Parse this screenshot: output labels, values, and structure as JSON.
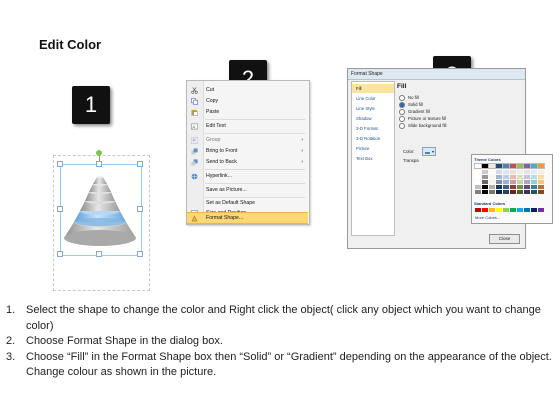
{
  "title": "Edit Color",
  "badges": [
    "1",
    "2",
    "3"
  ],
  "context_menu": {
    "items": [
      {
        "label": "Cut",
        "icon": "scissors-icon",
        "arrow": ""
      },
      {
        "label": "Copy",
        "icon": "copy-icon",
        "arrow": ""
      },
      {
        "label": "Paste",
        "icon": "paste-icon",
        "arrow": ""
      },
      {
        "label": "Edit Text",
        "icon": "edit-text-icon",
        "arrow": ""
      },
      {
        "label": "Group",
        "icon": "group-icon",
        "arrow": "›"
      },
      {
        "label": "Bring to Front",
        "icon": "bring-to-front-icon",
        "arrow": "›"
      },
      {
        "label": "Send to Back",
        "icon": "send-to-back-icon",
        "arrow": "›"
      },
      {
        "label": "Hyperlink...",
        "icon": "hyperlink-icon",
        "arrow": ""
      },
      {
        "label": "Save as Picture...",
        "icon": "",
        "arrow": ""
      },
      {
        "label": "Set as Default Shape",
        "icon": "",
        "arrow": ""
      },
      {
        "label": "Size and Position...",
        "icon": "size-position-icon",
        "arrow": ""
      },
      {
        "label": "Format Shape...",
        "icon": "format-shape-icon",
        "arrow": ""
      }
    ],
    "highlighted": "Format Shape..."
  },
  "dialog": {
    "title": "Format Shape",
    "sidebar": [
      "Fill",
      "Line Color",
      "Line Style",
      "Shadow",
      "3-D Format",
      "3-D Rotation",
      "Picture",
      "Text Box"
    ],
    "active_sidebar": "Fill",
    "heading": "Fill",
    "options": [
      "No fill",
      "Solid fill",
      "Gradient fill",
      "Picture or texture fill",
      "Slide background fill"
    ],
    "selected_option": "Solid fill",
    "color_label": "Color:",
    "transparency_label": "Transpa",
    "palette": {
      "theme_label": "Theme Colors",
      "standard_label": "Standard Colors",
      "more_label": "More Colors...",
      "theme_colors": [
        "#ffffff",
        "#000000",
        "#eeece1",
        "#1f497d",
        "#4f81bd",
        "#c0504d",
        "#9bbb59",
        "#8064a2",
        "#4bacc6",
        "#f79646"
      ],
      "standard_colors": [
        "#c00000",
        "#ff0000",
        "#ffc000",
        "#ffff00",
        "#92d050",
        "#00b050",
        "#00b0f0",
        "#0070c0",
        "#002060",
        "#7030a0"
      ]
    },
    "close_label": "Close"
  },
  "instructions": [
    {
      "num": "1.",
      "text": "Select the shape to change the color and Right click the object( click any object which you want to change color)"
    },
    {
      "num": "2.",
      "text": "Choose Format Shape in the dialog box."
    },
    {
      "num": "3.",
      "text": "Choose “Fill” in the Format Shape box then “Solid” or “Gradient” depending on the appearance of the object. Change colour as shown in the picture."
    }
  ],
  "colors": {
    "accent_blue": "#4f81bd",
    "highlight": "#fbd777",
    "pyramid_grey": "#b8b8b8",
    "pyramid_blue": "#7fb6e6"
  }
}
